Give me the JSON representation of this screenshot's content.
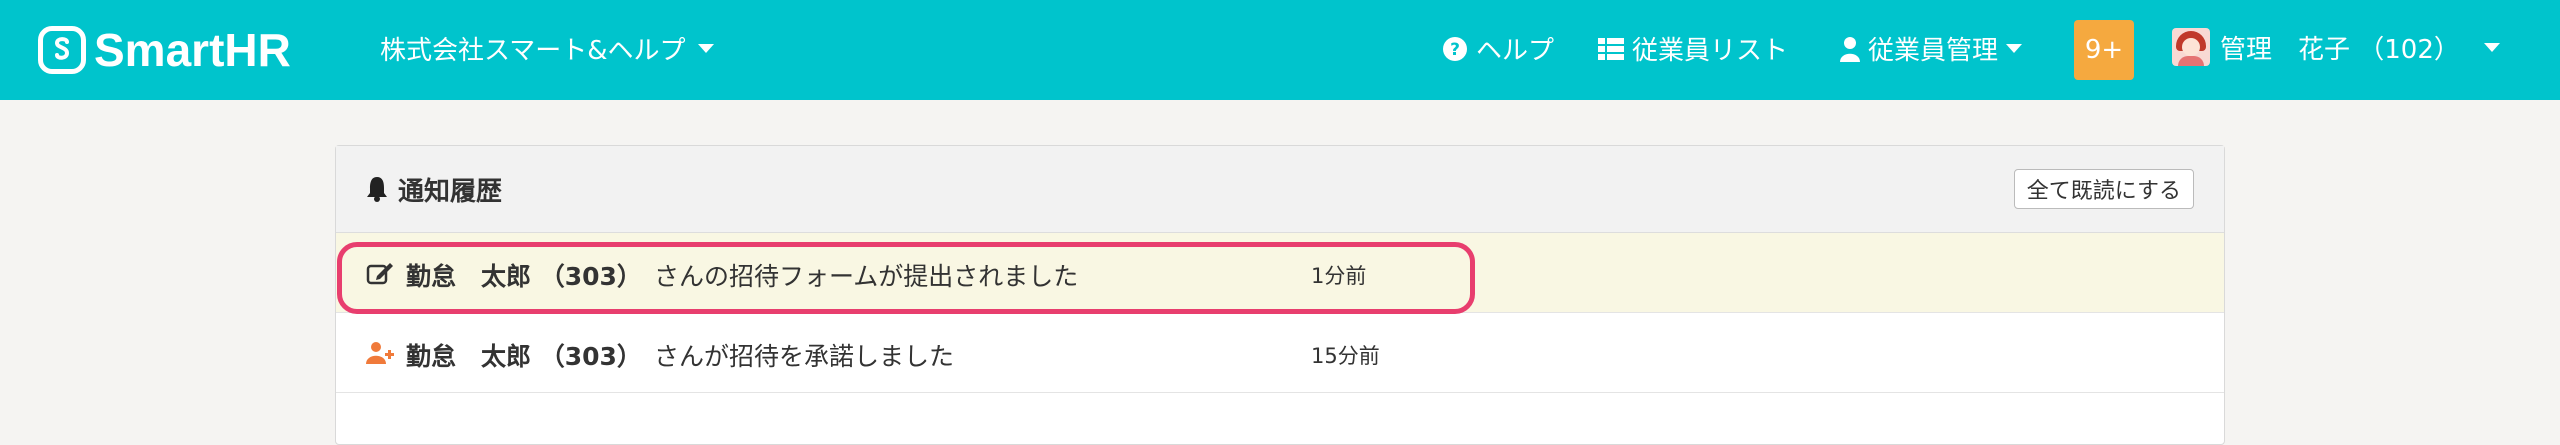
{
  "colors": {
    "brand": "#00c4cc",
    "badge": "#f5a93f",
    "unread_row": "#f9f7e3",
    "highlight": "#e83e6e",
    "new_user_icon": "#f07a3a"
  },
  "header": {
    "logo_text": "SmartHR",
    "company": "株式会社スマート&ヘルプ",
    "nav": {
      "help": "ヘルプ",
      "employee_list": "従業員リスト",
      "employee_manage": "従業員管理"
    },
    "notification_badge": "9+",
    "user": "管理　花子 （102）"
  },
  "panel": {
    "title": "通知履歴",
    "mark_all_read": "全て既読にする",
    "notifications": [
      {
        "icon": "edit-icon",
        "name": "勤怠　太郎 （303）",
        "message": "さんの招待フォームが提出されました",
        "time": "1分前",
        "unread": true
      },
      {
        "icon": "user-plus-icon",
        "name": "勤怠　太郎 （303）",
        "message": "さんが招待を承諾しました",
        "time": "15分前",
        "unread": false
      }
    ]
  }
}
